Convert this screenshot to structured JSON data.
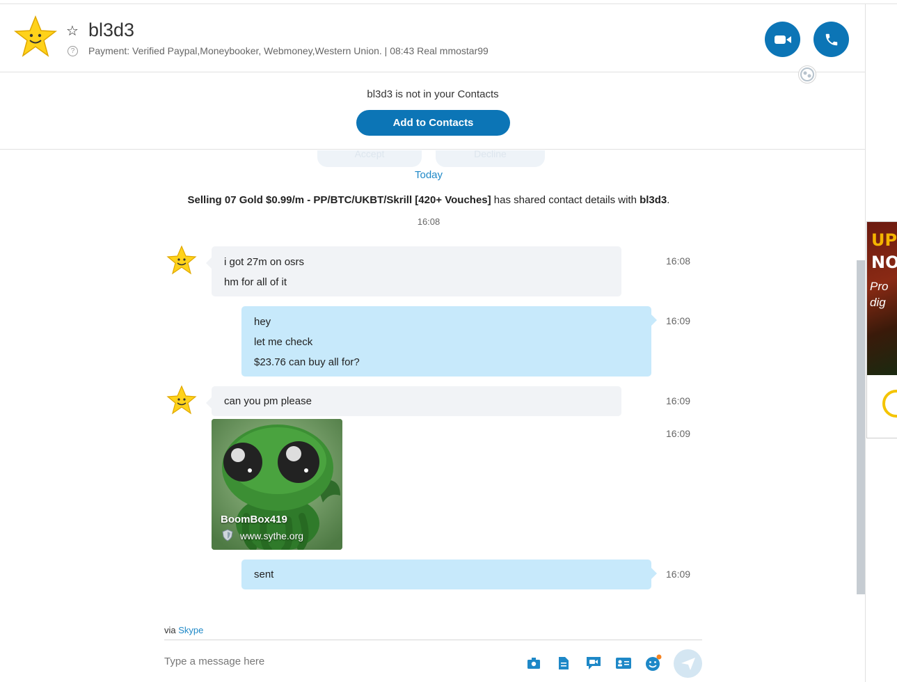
{
  "header": {
    "contact_name": "bl3d3",
    "mood": "Payment: Verified Paypal,Moneybooker, Webmoney,Western Union.  |  08:43 Real mmostar99"
  },
  "notice": {
    "text": "bl3d3 is not in your Contacts",
    "add_label": "Add to Contacts",
    "accept_label": "Accept",
    "decline_label": "Decline"
  },
  "conversation": {
    "day_label": "Today",
    "shared_group": "Selling 07 Gold $0.99/m - PP/BTC/UKBT/Skrill [420+ Vouches]",
    "shared_mid": " has shared contact details with ",
    "shared_contact": "bl3d3",
    "shared_end": ".",
    "shared_time": "16:08",
    "messages": [
      {
        "direction": "in",
        "lines": [
          "i got 27m on osrs",
          "hm for all of it"
        ],
        "time": "16:08"
      },
      {
        "direction": "out",
        "lines": [
          "hey",
          "let me check",
          "$23.76 can buy all for?"
        ],
        "time": "16:09"
      },
      {
        "direction": "in",
        "lines": [
          "can you pm please"
        ],
        "time": "16:09"
      },
      {
        "direction": "in",
        "type": "link-preview",
        "title": "BoomBox419",
        "url": "www.sythe.org",
        "time": "16:09"
      },
      {
        "direction": "out",
        "lines": [
          "sent"
        ],
        "time": "16:09"
      }
    ]
  },
  "composer": {
    "via_prefix": "via ",
    "via_link": "Skype",
    "placeholder": "Type a message here",
    "tools": [
      "media-gallery-icon",
      "file-icon",
      "video-message-icon",
      "contact-card-icon",
      "emoticon-icon",
      "send-icon"
    ]
  },
  "ad": {
    "line1": "UP",
    "line2": "NO",
    "line3": "Pro",
    "line4": "dig"
  },
  "colors": {
    "accent": "#0c75b6",
    "link": "#1e88c7",
    "incoming_bubble": "#f1f3f6",
    "outgoing_bubble": "#c7e9fb"
  }
}
